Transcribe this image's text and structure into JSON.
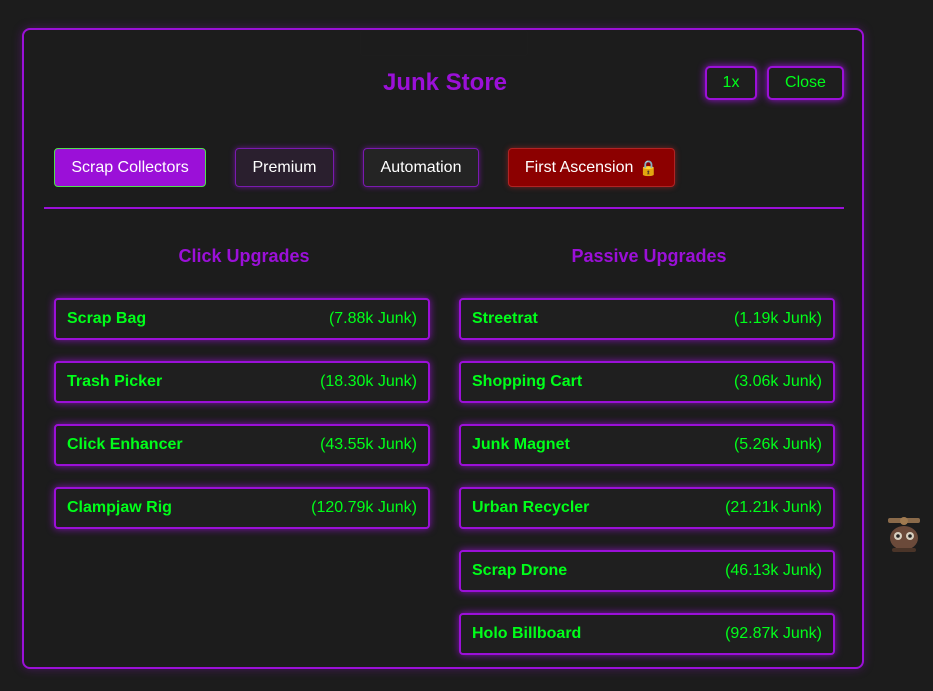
{
  "store": {
    "title": "Junk Store",
    "speed_label": "1x",
    "close_label": "Close"
  },
  "tabs": {
    "scrap_collectors": "Scrap Collectors",
    "premium": "Premium",
    "automation": "Automation",
    "first_ascension": "First Ascension",
    "active": "Scrap Collectors",
    "locked_icon": "lock-icon"
  },
  "sections": {
    "click_title": "Click Upgrades",
    "passive_title": "Passive Upgrades"
  },
  "click_upgrades": [
    {
      "name": "Scrap Bag",
      "cost": "(7.88k Junk)"
    },
    {
      "name": "Trash Picker",
      "cost": "(18.30k Junk)"
    },
    {
      "name": "Click Enhancer",
      "cost": "(43.55k Junk)"
    },
    {
      "name": "Clampjaw Rig",
      "cost": "(120.79k Junk)"
    }
  ],
  "passive_upgrades": [
    {
      "name": "Streetrat",
      "cost": "(1.19k Junk)"
    },
    {
      "name": "Shopping Cart",
      "cost": "(3.06k Junk)"
    },
    {
      "name": "Junk Magnet",
      "cost": "(5.26k Junk)"
    },
    {
      "name": "Urban Recycler",
      "cost": "(21.21k Junk)"
    },
    {
      "name": "Scrap Drone",
      "cost": "(46.13k Junk)"
    },
    {
      "name": "Holo Billboard",
      "cost": "(92.87k Junk)"
    }
  ],
  "colors": {
    "accent": "#9b10d8",
    "text_green": "#00ff1a",
    "ascension_red": "#8c0000",
    "background": "#1c1c1c"
  }
}
